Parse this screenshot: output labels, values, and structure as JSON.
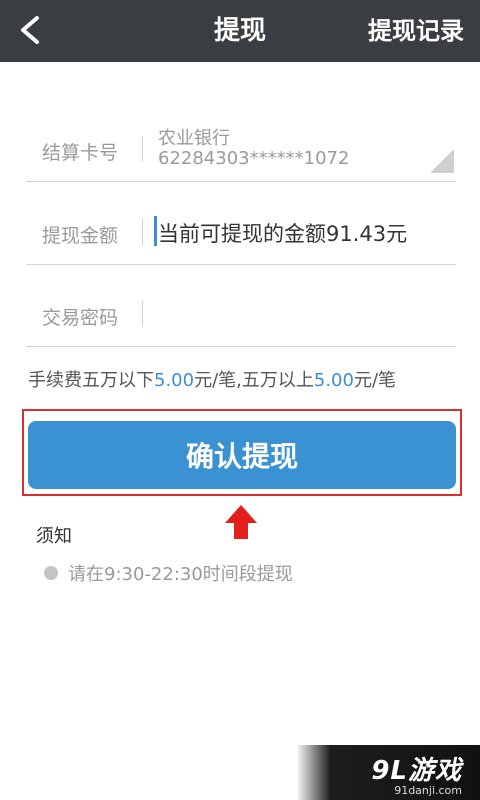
{
  "header": {
    "title": "提现",
    "right_link": "提现记录"
  },
  "form": {
    "card": {
      "label": "结算卡号",
      "bank": "农业银行",
      "number": "62284303******1072"
    },
    "amount": {
      "label": "提现金额",
      "placeholder": "当前可提现的金额91.43元",
      "value": ""
    },
    "password": {
      "label": "交易密码",
      "value": ""
    }
  },
  "fee": {
    "part1": "手续费五万以下",
    "fee1": "5.00",
    "part2": "元/笔,五万以上",
    "fee2": "5.00",
    "part3": "元/笔"
  },
  "confirm": {
    "label": "确认提现"
  },
  "notice": {
    "title": "须知",
    "items": [
      "请在9:30-22:30时间段提现"
    ]
  },
  "watermark": {
    "main": "9L游戏",
    "sub": "91danji.com"
  },
  "colors": {
    "header_bg": "#3a3d42",
    "accent": "#3a92d3",
    "highlight": "#d9302b"
  }
}
